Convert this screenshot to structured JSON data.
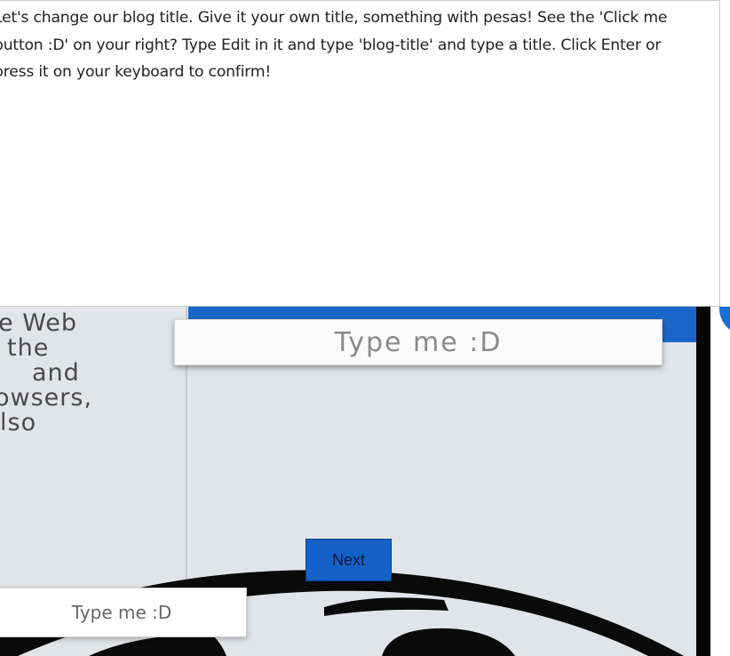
{
  "instructions": {
    "text": "Let's change our blog title. Give it your own title, something with pesas! See the 'Click me button :D' on your right? Type Edit in it and type 'blog-title' and type a title. Click Enter or press it on your keyboard to confirm!"
  },
  "left_panel": {
    "fragment_1": "e Web",
    "fragment_2": "the",
    "fragment_3": "and",
    "fragment_4": "owsers,",
    "fragment_5": "lso"
  },
  "main_input": {
    "placeholder": "Type me :D"
  },
  "next_button": {
    "label": "Next"
  },
  "bottom_input": {
    "placeholder": "Type me :D"
  },
  "colors": {
    "accent_blue": "#1a66c8",
    "button_blue": "#1561c8",
    "panel_gray": "#e1e5e9"
  }
}
